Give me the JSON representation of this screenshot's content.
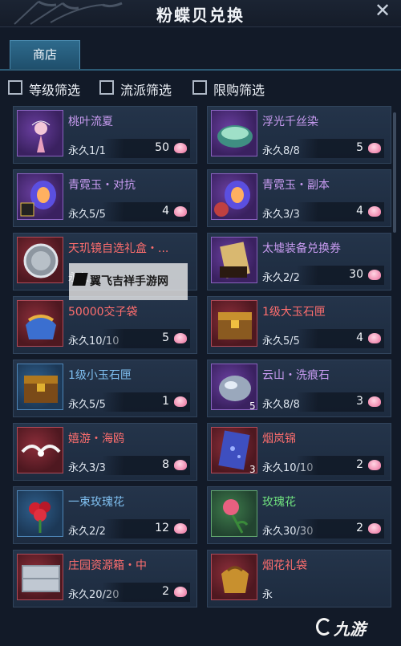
{
  "header": {
    "title": "粉蝶贝兑换",
    "close_glyph": "✕"
  },
  "tabs": [
    {
      "label": "商店",
      "active": true
    }
  ],
  "filters": [
    {
      "label": "等级筛选",
      "checked": false
    },
    {
      "label": "流派筛选",
      "checked": false
    },
    {
      "label": "限购筛选",
      "checked": false
    }
  ],
  "items": [
    {
      "name": "桃叶流夏",
      "stock": "永久1/1",
      "price": "50",
      "quality": "purple",
      "icon": "peach-leaf-figurine-icon"
    },
    {
      "name": "浮光千丝染",
      "stock": "永久8/8",
      "price": "5",
      "quality": "purple",
      "icon": "dye-bowl-icon"
    },
    {
      "name": "青霓玉・对抗",
      "stock": "永久5/5",
      "price": "4",
      "quality": "purple",
      "icon": "jade-pvp-icon"
    },
    {
      "name": "青霓玉・副本",
      "stock": "永久3/3",
      "price": "4",
      "quality": "purple",
      "icon": "jade-dungeon-icon"
    },
    {
      "name": "天玑镜自选礼盒・...",
      "stock": "永久",
      "price": "",
      "quality": "red",
      "icon": "mirror-gift-box-icon"
    },
    {
      "name": "太墟装备兑换券",
      "stock": "永久2/2",
      "price": "30",
      "quality": "purple",
      "icon": "equipment-voucher-icon"
    },
    {
      "name": "50000交子袋",
      "stock": "永久10/10",
      "price": "5",
      "quality": "red",
      "icon": "money-bag-icon"
    },
    {
      "name": "1级大玉石匣",
      "stock": "永久5/5",
      "price": "4",
      "quality": "red",
      "icon": "large-jade-chest-icon"
    },
    {
      "name": "1级小玉石匣",
      "stock": "永久5/5",
      "price": "1",
      "quality": "blue",
      "icon": "small-jade-chest-icon"
    },
    {
      "name": "云山・洗痕石",
      "stock": "永久8/8",
      "price": "3",
      "quality": "purple",
      "icon": "washing-stone-icon",
      "badge": "5"
    },
    {
      "name": "嬉游・海鸥",
      "stock": "永久3/3",
      "price": "8",
      "quality": "red",
      "icon": "seagull-icon"
    },
    {
      "name": "烟岚锦",
      "stock": "永久10/10",
      "price": "2",
      "quality": "red",
      "icon": "brocade-cloth-icon",
      "badge": "3"
    },
    {
      "name": "一束玫瑰花",
      "stock": "永久2/2",
      "price": "12",
      "quality": "blue",
      "icon": "rose-bouquet-icon"
    },
    {
      "name": "玫瑰花",
      "stock": "永久30/30",
      "price": "2",
      "quality": "green",
      "icon": "rose-icon"
    },
    {
      "name": "庄园资源箱・中",
      "stock": "永久20/20",
      "price": "2",
      "quality": "red",
      "icon": "resource-crate-icon"
    },
    {
      "name": "烟花礼袋",
      "stock": "永",
      "price": "",
      "quality": "red",
      "icon": "firework-bag-icon"
    }
  ],
  "watermark": {
    "text": "翼飞吉祥手游网"
  },
  "corner_logo": {
    "text": "九游"
  }
}
